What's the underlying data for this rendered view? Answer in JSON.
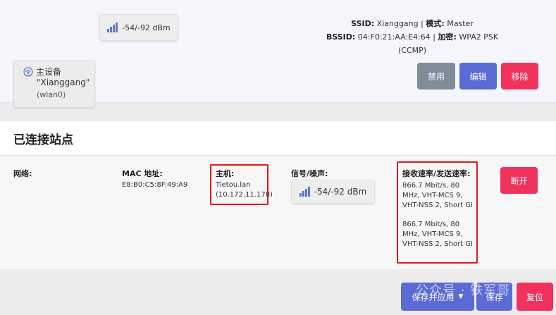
{
  "top_card": {
    "signal": "-54/-92 dBm",
    "ssid_label": "SSID:",
    "ssid_value": "Xianggang",
    "separator": "|",
    "mode_label": "模式:",
    "mode_value": "Master",
    "bssid_label": "BSSID:",
    "bssid_value": "04:F0:21:AA:E4:64",
    "enc_label": "加密:",
    "enc_value": "WPA2 PSK (CCMP)",
    "buttons": {
      "disable": "禁用",
      "edit": "编辑",
      "remove": "移除"
    }
  },
  "stations": {
    "title": "已连接站点",
    "network_label": "网络:",
    "network_name": "主设备",
    "network_ssid": "\"Xianggang\"",
    "network_iface": "(wlan0)",
    "mac_label": "MAC 地址:",
    "mac_value": "E8:B0:C5:8F:49:A9",
    "host_label": "主机:",
    "host_name": "Tietou.lan",
    "host_ip": "(10.172.11.178)",
    "signal_label": "信号/噪声:",
    "signal_value": "-54/-92 dBm",
    "rate_label": "接收速率/发送速率:",
    "rx_rate": "866.7 Mbit/s, 80 MHz, VHT-MCS 9, VHT-NSS 2, Short GI",
    "tx_rate": "866.7 Mbit/s, 80 MHz, VHT-MCS 9, VHT-NSS 2, Short GI",
    "disconnect_button": "断开"
  },
  "footer": {
    "save_apply": "保存并应用",
    "save": "保存",
    "reset": "复位"
  },
  "watermark": "公众号 · 铁军哥",
  "colors": {
    "primary": "#5b6bd6",
    "danger": "#f0325c",
    "neutral": "#7f8c99",
    "highlight_border": "#e0191a"
  },
  "icons": [
    "signal-bars-icon",
    "wifi-icon",
    "caret-down-icon"
  ]
}
